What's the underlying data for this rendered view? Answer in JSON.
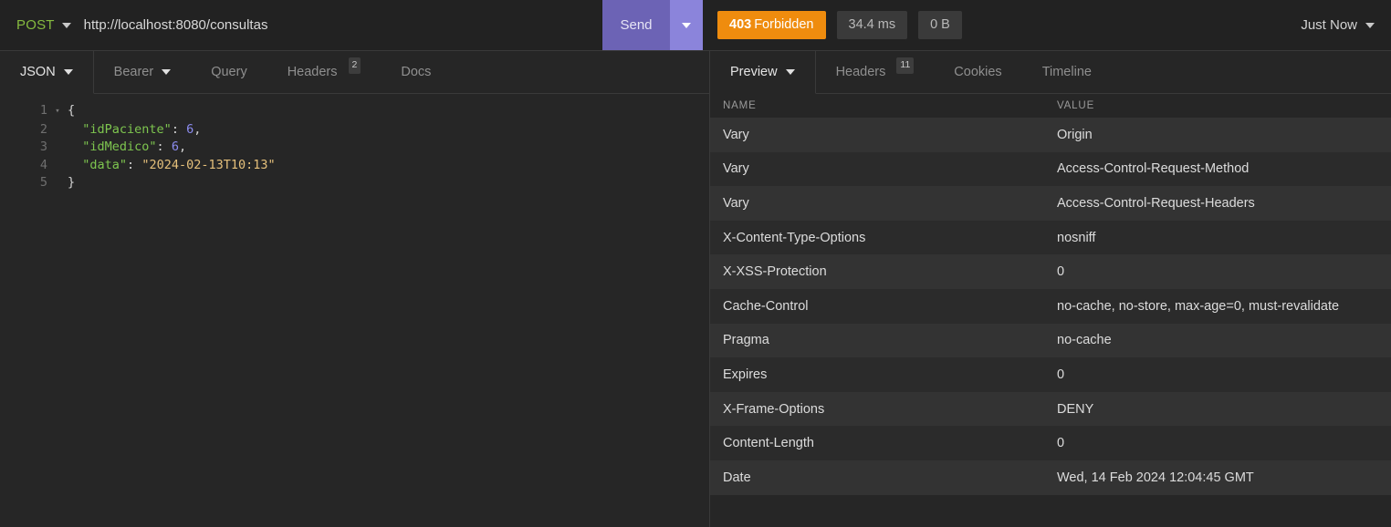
{
  "request_bar": {
    "method": "POST",
    "method_caret_icon": "chevron-down-icon",
    "url": "http://localhost:8080/consultas",
    "send_label": "Send",
    "send_caret_icon": "chevron-down-icon"
  },
  "status_bar": {
    "status_code": "403",
    "status_text": "Forbidden",
    "status_color": "#ef8c0e",
    "time": "34.4 ms",
    "size": "0 B",
    "timestamp_label": "Just Now",
    "timestamp_caret_icon": "chevron-down-icon"
  },
  "request_tabs": {
    "body_type": {
      "label": "JSON",
      "caret_icon": "chevron-down-icon",
      "active": true
    },
    "auth_type": {
      "label": "Bearer",
      "caret_icon": "chevron-down-icon"
    },
    "items": [
      {
        "label": "Query",
        "badge": ""
      },
      {
        "label": "Headers",
        "badge": "2"
      },
      {
        "label": "Docs",
        "badge": ""
      }
    ]
  },
  "response_tabs": {
    "preview": {
      "label": "Preview",
      "caret_icon": "chevron-down-icon",
      "active": true
    },
    "items": [
      {
        "label": "Headers",
        "badge": "11",
        "active": true
      },
      {
        "label": "Cookies",
        "badge": ""
      },
      {
        "label": "Timeline",
        "badge": ""
      }
    ]
  },
  "editor": {
    "lines": [
      {
        "num": "1",
        "fold": "▾",
        "tokens": [
          {
            "t": "{",
            "c": "tk-punc"
          }
        ]
      },
      {
        "num": "2",
        "fold": "",
        "tokens": [
          {
            "t": "  ",
            "c": "tk-punc"
          },
          {
            "t": "\"idPaciente\"",
            "c": "tk-key"
          },
          {
            "t": ": ",
            "c": "tk-punc"
          },
          {
            "t": "6",
            "c": "tk-num"
          },
          {
            "t": ",",
            "c": "tk-punc"
          }
        ]
      },
      {
        "num": "3",
        "fold": "",
        "tokens": [
          {
            "t": "  ",
            "c": "tk-punc"
          },
          {
            "t": "\"idMedico\"",
            "c": "tk-key"
          },
          {
            "t": ": ",
            "c": "tk-punc"
          },
          {
            "t": "6",
            "c": "tk-num"
          },
          {
            "t": ",",
            "c": "tk-punc"
          }
        ]
      },
      {
        "num": "4",
        "fold": "",
        "tokens": [
          {
            "t": "  ",
            "c": "tk-punc"
          },
          {
            "t": "\"data\"",
            "c": "tk-key"
          },
          {
            "t": ": ",
            "c": "tk-punc"
          },
          {
            "t": "\"2024-02-13T10:13\"",
            "c": "tk-str"
          }
        ]
      },
      {
        "num": "5",
        "fold": "",
        "tokens": [
          {
            "t": "}",
            "c": "tk-punc"
          }
        ]
      }
    ]
  },
  "headers_table": {
    "columns": [
      "NAME",
      "VALUE"
    ],
    "rows": [
      {
        "name": "Vary",
        "value": "Origin"
      },
      {
        "name": "Vary",
        "value": "Access-Control-Request-Method"
      },
      {
        "name": "Vary",
        "value": "Access-Control-Request-Headers"
      },
      {
        "name": "X-Content-Type-Options",
        "value": "nosniff"
      },
      {
        "name": "X-XSS-Protection",
        "value": "0"
      },
      {
        "name": "Cache-Control",
        "value": "no-cache, no-store, max-age=0, must-revalidate"
      },
      {
        "name": "Pragma",
        "value": "no-cache"
      },
      {
        "name": "Expires",
        "value": "0"
      },
      {
        "name": "X-Frame-Options",
        "value": "DENY"
      },
      {
        "name": "Content-Length",
        "value": "0"
      },
      {
        "name": "Date",
        "value": "Wed, 14 Feb 2024 12:04:45 GMT"
      }
    ]
  }
}
